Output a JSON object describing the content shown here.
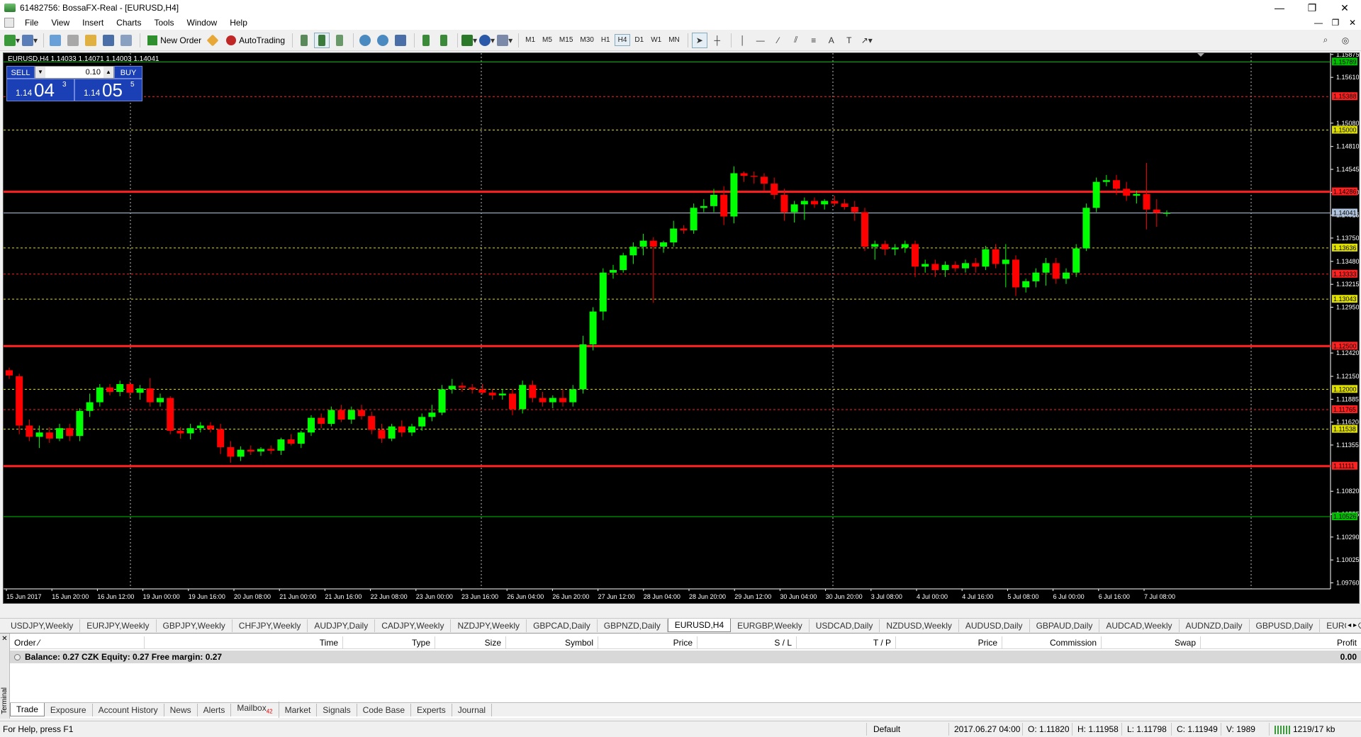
{
  "window": {
    "title": "61482756: BossaFX-Real - [EURUSD,H4]",
    "minimize": "—",
    "maximize": "❐",
    "close": "✕"
  },
  "menu": [
    "File",
    "View",
    "Insert",
    "Charts",
    "Tools",
    "Window",
    "Help"
  ],
  "toolbar": {
    "new_order": "New Order",
    "auto_trading": "AutoTrading",
    "timeframes": [
      "M1",
      "M5",
      "M15",
      "M30",
      "H1",
      "H4",
      "D1",
      "W1",
      "MN"
    ],
    "active_timeframe": "H4"
  },
  "chart": {
    "header": "EURUSD,H4  1.14033 1.14071 1.14003 1.14041",
    "trade_panel": {
      "sell": "SELL",
      "buy": "BUY",
      "lot": "0.10",
      "bid_small": "1.14",
      "bid_big": "04",
      "bid_sup": "3",
      "ask_small": "1.14",
      "ask_big": "05",
      "ask_sup": "5"
    }
  },
  "chart_data": {
    "type": "candlestick",
    "symbol": "EURUSD",
    "timeframe": "H4",
    "ylim": [
      1.0969,
      1.1589
    ],
    "y_ticks": [
      "1.15875",
      "1.15610",
      "1.15080",
      "1.14810",
      "1.14545",
      "1.14280",
      "1.14015",
      "1.13750",
      "1.13480",
      "1.13215",
      "1.12950",
      "1.12420",
      "1.12150",
      "1.11885",
      "1.11620",
      "1.11355",
      "1.10820",
      "1.10555",
      "1.10290",
      "1.10025",
      "1.09760"
    ],
    "x_ticks": [
      "15 Jun 2017",
      "15 Jun 20:00",
      "16 Jun 12:00",
      "19 Jun 00:00",
      "19 Jun 16:00",
      "20 Jun 08:00",
      "21 Jun 00:00",
      "21 Jun 16:00",
      "22 Jun 08:00",
      "23 Jun 00:00",
      "23 Jun 16:00",
      "26 Jun 04:00",
      "26 Jun 20:00",
      "27 Jun 12:00",
      "28 Jun 04:00",
      "28 Jun 20:00",
      "29 Jun 12:00",
      "30 Jun 04:00",
      "30 Jun 20:00",
      "3 Jul 08:00",
      "4 Jul 00:00",
      "4 Jul 16:00",
      "5 Jul 08:00",
      "6 Jul 00:00",
      "6 Jul 16:00",
      "7 Jul 08:00"
    ],
    "horizontal_levels": [
      {
        "price": 1.15789,
        "label": "1.15789",
        "color": "#00c000",
        "style": "solid"
      },
      {
        "price": 1.15388,
        "label": "1.15388",
        "color": "#ff2020",
        "style": "dashed"
      },
      {
        "price": 1.15,
        "label": "1.15000",
        "color": "#e0e000",
        "style": "dashed"
      },
      {
        "price": 1.14286,
        "label": "1.14286",
        "color": "#ff2020",
        "style": "thick"
      },
      {
        "price": 1.14041,
        "label": "1.14041",
        "color": "#b0c4de",
        "style": "solid"
      },
      {
        "price": 1.13636,
        "label": "1.13636",
        "color": "#e0e000",
        "style": "dashed"
      },
      {
        "price": 1.13333,
        "label": "1.13333",
        "color": "#ff2020",
        "style": "dashed"
      },
      {
        "price": 1.13043,
        "label": "1.13043",
        "color": "#e0e000",
        "style": "dashed"
      },
      {
        "price": 1.125,
        "label": "1.12500",
        "color": "#ff2020",
        "style": "thick"
      },
      {
        "price": 1.12,
        "label": "1.12000",
        "color": "#e0e000",
        "style": "dashed"
      },
      {
        "price": 1.11765,
        "label": "1.11765",
        "color": "#ff2020",
        "style": "dashed"
      },
      {
        "price": 1.11538,
        "label": "1.11538",
        "color": "#e0e000",
        "style": "dashed"
      },
      {
        "price": 1.11111,
        "label": "1.11111",
        "color": "#ff2020",
        "style": "thick"
      },
      {
        "price": 1.10526,
        "label": "1.10526",
        "color": "#00c000",
        "style": "solid"
      }
    ],
    "candles": [
      [
        1.1222,
        1.1225,
        1.1212,
        1.1216
      ],
      [
        1.1215,
        1.1218,
        1.1148,
        1.1158
      ],
      [
        1.1158,
        1.1165,
        1.114,
        1.1145
      ],
      [
        1.1145,
        1.1158,
        1.1132,
        1.115
      ],
      [
        1.115,
        1.1156,
        1.1138,
        1.1143
      ],
      [
        1.1143,
        1.116,
        1.114,
        1.1155
      ],
      [
        1.1155,
        1.116,
        1.114,
        1.1146
      ],
      [
        1.1146,
        1.1178,
        1.114,
        1.1175
      ],
      [
        1.1175,
        1.1195,
        1.1168,
        1.1185
      ],
      [
        1.1185,
        1.1206,
        1.118,
        1.1202
      ],
      [
        1.1202,
        1.1206,
        1.1193,
        1.1197
      ],
      [
        1.1197,
        1.121,
        1.1192,
        1.1206
      ],
      [
        1.1206,
        1.1209,
        1.119,
        1.1196
      ],
      [
        1.1196,
        1.1205,
        1.1188,
        1.1201
      ],
      [
        1.1201,
        1.1213,
        1.118,
        1.1185
      ],
      [
        1.1185,
        1.1195,
        1.118,
        1.119
      ],
      [
        1.119,
        1.1192,
        1.1148,
        1.1152
      ],
      [
        1.1152,
        1.1156,
        1.1143,
        1.1149
      ],
      [
        1.1149,
        1.116,
        1.1142,
        1.1155
      ],
      [
        1.1155,
        1.1162,
        1.115,
        1.1158
      ],
      [
        1.1158,
        1.1162,
        1.115,
        1.1154
      ],
      [
        1.1154,
        1.116,
        1.1125,
        1.1133
      ],
      [
        1.1133,
        1.114,
        1.1115,
        1.1122
      ],
      [
        1.1122,
        1.1134,
        1.1117,
        1.113
      ],
      [
        1.113,
        1.1135,
        1.1124,
        1.1128
      ],
      [
        1.1128,
        1.1133,
        1.1123,
        1.1131
      ],
      [
        1.1131,
        1.1135,
        1.1125,
        1.1129
      ],
      [
        1.1129,
        1.1144,
        1.1124,
        1.1142
      ],
      [
        1.1142,
        1.1148,
        1.1135,
        1.1137
      ],
      [
        1.1137,
        1.1152,
        1.1132,
        1.115
      ],
      [
        1.115,
        1.117,
        1.1146,
        1.1167
      ],
      [
        1.1167,
        1.1172,
        1.1155,
        1.116
      ],
      [
        1.116,
        1.118,
        1.1157,
        1.1176
      ],
      [
        1.1176,
        1.1182,
        1.1162,
        1.1165
      ],
      [
        1.1165,
        1.118,
        1.116,
        1.1176
      ],
      [
        1.1176,
        1.1182,
        1.1165,
        1.1169
      ],
      [
        1.1169,
        1.1174,
        1.1148,
        1.1153
      ],
      [
        1.1153,
        1.116,
        1.1138,
        1.1143
      ],
      [
        1.1143,
        1.116,
        1.114,
        1.1157
      ],
      [
        1.1157,
        1.1164,
        1.1145,
        1.115
      ],
      [
        1.115,
        1.116,
        1.1146,
        1.1157
      ],
      [
        1.1157,
        1.1172,
        1.1152,
        1.1168
      ],
      [
        1.1168,
        1.1182,
        1.1163,
        1.1173
      ],
      [
        1.1173,
        1.1205,
        1.117,
        1.12
      ],
      [
        1.12,
        1.1212,
        1.1195,
        1.1204
      ],
      [
        1.1204,
        1.1208,
        1.1197,
        1.1202
      ],
      [
        1.1202,
        1.1206,
        1.1195,
        1.12
      ],
      [
        1.12,
        1.1206,
        1.1194,
        1.1196
      ],
      [
        1.1196,
        1.12,
        1.1188,
        1.1193
      ],
      [
        1.1193,
        1.12,
        1.1188,
        1.1195
      ],
      [
        1.1195,
        1.12,
        1.117,
        1.1177
      ],
      [
        1.1177,
        1.121,
        1.1172,
        1.1205
      ],
      [
        1.1205,
        1.121,
        1.1185,
        1.119
      ],
      [
        1.119,
        1.1197,
        1.118,
        1.1185
      ],
      [
        1.1185,
        1.1193,
        1.1178,
        1.119
      ],
      [
        1.119,
        1.12,
        1.118,
        1.1185
      ],
      [
        1.1185,
        1.1205,
        1.118,
        1.12
      ],
      [
        1.12,
        1.1262,
        1.1195,
        1.1252
      ],
      [
        1.1252,
        1.1295,
        1.1245,
        1.129
      ],
      [
        1.129,
        1.134,
        1.128,
        1.1335
      ],
      [
        1.1335,
        1.1344,
        1.1328,
        1.1338
      ],
      [
        1.1338,
        1.1358,
        1.1335,
        1.1355
      ],
      [
        1.1355,
        1.137,
        1.1345,
        1.1365
      ],
      [
        1.1365,
        1.138,
        1.1355,
        1.1372
      ],
      [
        1.1372,
        1.1376,
        1.13,
        1.1365
      ],
      [
        1.1365,
        1.1372,
        1.1358,
        1.137
      ],
      [
        1.137,
        1.1395,
        1.1365,
        1.1386
      ],
      [
        1.1386,
        1.139,
        1.138,
        1.1384
      ],
      [
        1.1384,
        1.1415,
        1.138,
        1.141
      ],
      [
        1.141,
        1.142,
        1.1405,
        1.1412
      ],
      [
        1.1412,
        1.1432,
        1.1405,
        1.1425
      ],
      [
        1.1425,
        1.1435,
        1.139,
        1.14
      ],
      [
        1.14,
        1.1458,
        1.1392,
        1.145
      ],
      [
        1.145,
        1.1452,
        1.144,
        1.1447
      ],
      [
        1.1447,
        1.1452,
        1.1438,
        1.1446
      ],
      [
        1.1446,
        1.145,
        1.143,
        1.1438
      ],
      [
        1.1438,
        1.1445,
        1.142,
        1.1425
      ],
      [
        1.1425,
        1.1432,
        1.1395,
        1.1405
      ],
      [
        1.1405,
        1.1418,
        1.1393,
        1.1414
      ],
      [
        1.1414,
        1.1422,
        1.1396,
        1.1418
      ],
      [
        1.1418,
        1.1422,
        1.141,
        1.1414
      ],
      [
        1.1414,
        1.142,
        1.1408,
        1.1418
      ],
      [
        1.1418,
        1.1424,
        1.1412,
        1.1415
      ],
      [
        1.1415,
        1.142,
        1.1408,
        1.1411
      ],
      [
        1.1411,
        1.1418,
        1.1395,
        1.1405
      ],
      [
        1.1405,
        1.141,
        1.136,
        1.1365
      ],
      [
        1.1365,
        1.1372,
        1.135,
        1.1368
      ],
      [
        1.1368,
        1.1372,
        1.1355,
        1.1362
      ],
      [
        1.1362,
        1.1368,
        1.1355,
        1.1364
      ],
      [
        1.1364,
        1.1372,
        1.1358,
        1.1368
      ],
      [
        1.1368,
        1.1372,
        1.133,
        1.1342
      ],
      [
        1.1342,
        1.135,
        1.1335,
        1.1345
      ],
      [
        1.1345,
        1.135,
        1.133,
        1.1338
      ],
      [
        1.1338,
        1.1348,
        1.133,
        1.1344
      ],
      [
        1.1344,
        1.1348,
        1.1336,
        1.134
      ],
      [
        1.134,
        1.135,
        1.1335,
        1.1346
      ],
      [
        1.1346,
        1.1352,
        1.1335,
        1.1342
      ],
      [
        1.1342,
        1.1366,
        1.1338,
        1.1362
      ],
      [
        1.1362,
        1.1368,
        1.134,
        1.1345
      ],
      [
        1.1345,
        1.1368,
        1.1318,
        1.135
      ],
      [
        1.135,
        1.1355,
        1.1308,
        1.1318
      ],
      [
        1.1318,
        1.1328,
        1.1312,
        1.1325
      ],
      [
        1.1325,
        1.134,
        1.1318,
        1.1335
      ],
      [
        1.1335,
        1.1352,
        1.132,
        1.1346
      ],
      [
        1.1346,
        1.1352,
        1.1322,
        1.1328
      ],
      [
        1.1328,
        1.134,
        1.1322,
        1.1335
      ],
      [
        1.1335,
        1.1368,
        1.133,
        1.1363
      ],
      [
        1.1363,
        1.1415,
        1.136,
        1.141
      ],
      [
        1.141,
        1.1445,
        1.1405,
        1.144
      ],
      [
        1.144,
        1.1448,
        1.1435,
        1.1442
      ],
      [
        1.1442,
        1.1448,
        1.1425,
        1.1432
      ],
      [
        1.1432,
        1.144,
        1.1418,
        1.1424
      ],
      [
        1.1424,
        1.143,
        1.1415,
        1.1426
      ],
      [
        1.1426,
        1.1462,
        1.1385,
        1.1408
      ],
      [
        1.1408,
        1.142,
        1.1388,
        1.1404
      ],
      [
        1.1404,
        1.1407,
        1.14,
        1.1404
      ]
    ]
  },
  "chart_tabs": [
    "USDJPY,Weekly",
    "EURJPY,Weekly",
    "GBPJPY,Weekly",
    "CHFJPY,Weekly",
    "AUDJPY,Daily",
    "CADJPY,Weekly",
    "NZDJPY,Weekly",
    "GBPCAD,Daily",
    "GBPNZD,Daily",
    "EURUSD,H4",
    "EURGBP,Weekly",
    "USDCAD,Daily",
    "NZDUSD,Weekly",
    "AUDUSD,Daily",
    "GBPAUD,Daily",
    "AUDCAD,Weekly",
    "AUDNZD,Daily",
    "GBPUSD,Daily",
    "EURCZK,We"
  ],
  "active_chart_tab": "EURUSD,H4",
  "terminal": {
    "side_label": "Terminal",
    "columns": [
      "Order",
      "Time",
      "Type",
      "Size",
      "Symbol",
      "Price",
      "S / L",
      "T / P",
      "Price",
      "Commission",
      "Swap",
      "Profit"
    ],
    "balance_text": "Balance: 0.27 CZK  Equity: 0.27  Free margin: 0.27",
    "balance_profit": "0.00",
    "tabs": [
      "Trade",
      "Exposure",
      "Account History",
      "News",
      "Alerts",
      "Mailbox",
      "Market",
      "Signals",
      "Code Base",
      "Experts",
      "Journal"
    ],
    "mailbox_count": "42",
    "active_tab": "Trade"
  },
  "status": {
    "help": "For Help, press F1",
    "profile": "Default",
    "datetime": "2017.06.27 04:00",
    "open": "O: 1.11820",
    "high": "H: 1.11958",
    "low": "L: 1.11798",
    "close": "C: 1.11949",
    "volume": "V: 1989",
    "traffic": "1219/17 kb"
  },
  "colors": {
    "bull": "#00ff00",
    "bear": "#ff0000",
    "chart_bg": "#000000",
    "grid": "#ffffff"
  }
}
